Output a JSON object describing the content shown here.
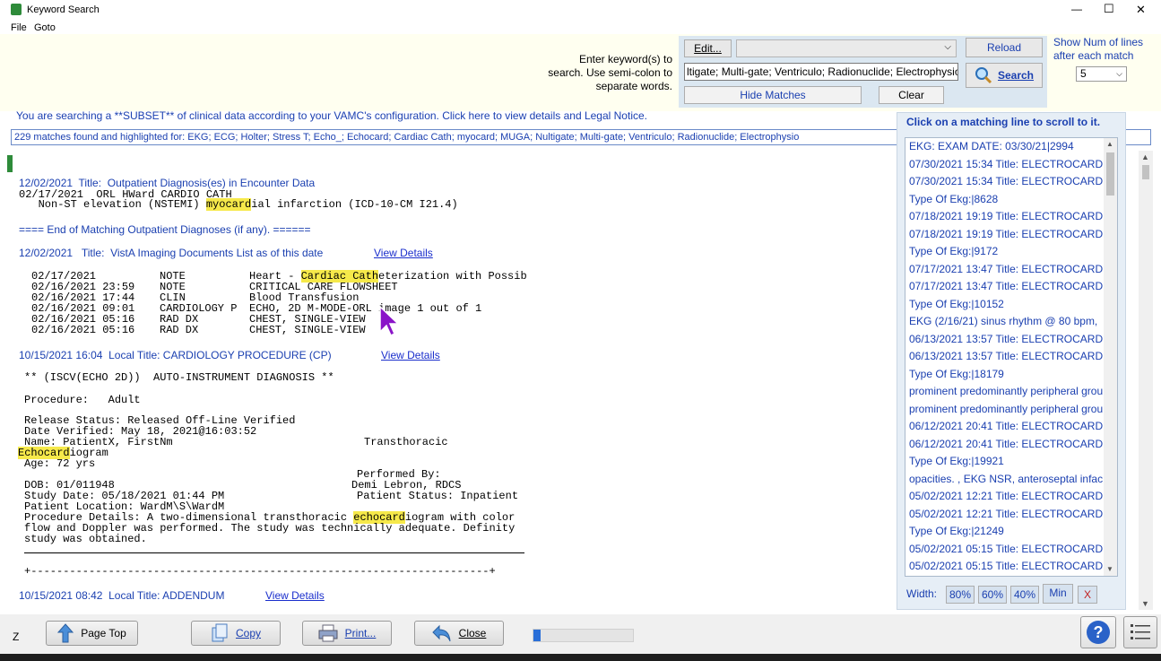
{
  "window": {
    "title": "Keyword Search",
    "min": "—",
    "max": "☐",
    "close": "✕"
  },
  "menu": [
    "File",
    "Goto"
  ],
  "search": {
    "instructions_line1": "Enter keyword(s) to",
    "instructions_line2": "search. Use semi-colon to",
    "instructions_line3": "separate words.",
    "edit_label": "Edit...",
    "keywords_value": "ltigate; Multi-gate; Ventriculo; Radionuclide; Electrophysio",
    "reload_label": "Reload",
    "search_label": "Search",
    "hide_matches_label": "Hide Matches",
    "clear_label": "Clear",
    "lines_label_1": "Show Num of lines",
    "lines_label_2": "after each match",
    "lines_value": "5"
  },
  "notice": "You are searching a **SUBSET** of clinical data according to your VAMC's configuration. Click here to view details and Legal Notice.",
  "matches_summary": "229 matches found and highlighted for: EKG; ECG; Holter; Stress T; Echo_; Echocard; Cardiac Cath; myocard; MUGA; Nultigate; Multi-gate; Ventriculo; Radionuclide; Electrophysio",
  "doc": {
    "sec1_title": "12/02/2021  Title:  Outpatient Diagnosis(es) in Encounter Data",
    "sec1_line1": "02/17/2021  ORL HWard CARDIO CATH",
    "sec1_line2_pre": "   Non-ST elevation (NSTEMI) ",
    "sec1_line2_hl": "myocard",
    "sec1_line2_post": "ial infarction (ICD-10-CM I21.4)",
    "sec1_end": "==== End of Matching Outpatient Diagnoses (if any). ======",
    "sec2_title": "12/02/2021   Title:  VistA Imaging Documents List as of this date",
    "view_details": "View Details",
    "sec2_rows": [
      {
        "date": "02/17/2021",
        "type": "NOTE",
        "pre": "Heart - ",
        "hl": "Cardiac Cath",
        "post": "eterization with Possib"
      },
      {
        "date": "02/16/2021 23:59",
        "type": "NOTE",
        "pre": "CRITICAL CARE FLOWSHEET",
        "hl": "",
        "post": ""
      },
      {
        "date": "02/16/2021 17:44",
        "type": "CLIN",
        "pre": "Blood Transfusion",
        "hl": "",
        "post": ""
      },
      {
        "date": "02/16/2021 09:01",
        "type": "CARDIOLOGY P",
        "pre": "ECHO, 2D M-MODE-ORL image 1 out of 1",
        "hl": "",
        "post": ""
      },
      {
        "date": "02/16/2021 05:16",
        "type": "RAD DX",
        "pre": "CHEST, SINGLE-VIEW",
        "hl": "",
        "post": ""
      },
      {
        "date": "02/16/2021 05:16",
        "type": "RAD DX",
        "pre": "CHEST, SINGLE-VIEW",
        "hl": "",
        "post": ""
      }
    ],
    "sec3_title": "10/15/2021 16:04  Local Title: CARDIOLOGY PROCEDURE (CP)",
    "sec3_header": "** (ISCV(ECHO 2D))  AUTO-INSTRUMENT DIAGNOSIS **",
    "procedure": "Procedure:   Adult",
    "release": "Release Status: Released Off-Line Verified",
    "verified": "Date Verified: May 18, 2021@16:03:52",
    "name": "Name: PatientX, FirstNm",
    "transthoracic": "Transthoracic",
    "echo_hl": "Echocard",
    "echo_post": "iogram",
    "age": "Age: 72 yrs",
    "performed_by": "Performed By:",
    "dob": "DOB: 01/011948",
    "performer": "Demi Lebron, RDCS",
    "study_date": "Study Date: 05/18/2021 01:44 PM",
    "patient_status": "Patient Status: Inpatient",
    "location": "Patient Location: WardM\\S\\WardM",
    "details_pre": "Procedure Details: A two-dimensional transthoracic ",
    "details_hl": "echocard",
    "details_post": "iogram with color",
    "details_2": "flow and Doppler was performed. The study was technically adequate. Definity",
    "details_3": "study was obtained.",
    "separator": "+-----------------------------------------------------------------------+",
    "sec4_title": "10/15/2021 08:42  Local Title: ADDENDUM"
  },
  "matchpanel": {
    "header": "Click on a matching  line to scroll to it.",
    "items": [
      "EKG: EXAM DATE:  03/30/21|2994",
      "07/30/2021 15:34  Title: ELECTROCARD",
      "07/30/2021 15:34  Title: ELECTROCARD",
      "Type Of Ekg:|8628",
      "07/18/2021 19:19  Title: ELECTROCARD",
      "07/18/2021 19:19  Title: ELECTROCARD",
      "Type Of Ekg:|9172",
      "07/17/2021 13:47  Title: ELECTROCARD",
      "07/17/2021 13:47  Title: ELECTROCARD",
      "Type Of Ekg:|10152",
      "EKG (2/16/21) sinus rhythm @ 80 bpm,",
      "06/13/2021 13:57  Title: ELECTROCARD",
      "06/13/2021 13:57  Title: ELECTROCARD",
      "Type Of Ekg:|18179",
      "prominent predominantly peripheral  grou",
      "prominent predominantly peripheral  grou",
      "06/12/2021 20:41  Title: ELECTROCARD",
      "06/12/2021 20:41  Title: ELECTROCARD",
      "Type Of Ekg:|19921",
      "opacities. ,  EKG NSR, anteroseptal infac",
      "05/02/2021 12:21  Title: ELECTROCARD",
      "05/02/2021 12:21  Title: ELECTROCARD",
      "Type Of Ekg:|21249",
      "05/02/2021 05:15  Title: ELECTROCARD",
      "05/02/2021 05:15  Title: ELECTROCARD"
    ],
    "width_label": "Width:",
    "width_80": "80%",
    "width_60": "60%",
    "width_40": "40%",
    "width_min": "Min",
    "width_close": "X"
  },
  "bottom": {
    "z_label": "Z",
    "page_top": "Page Top",
    "copy": "Copy",
    "print": "Print...",
    "close": "Close",
    "help": "?"
  },
  "colors": {
    "accent": "#1a3fb0",
    "highlight": "#f6e94a",
    "panel": "#dbe7f1",
    "cursor": "#8a14c8"
  }
}
